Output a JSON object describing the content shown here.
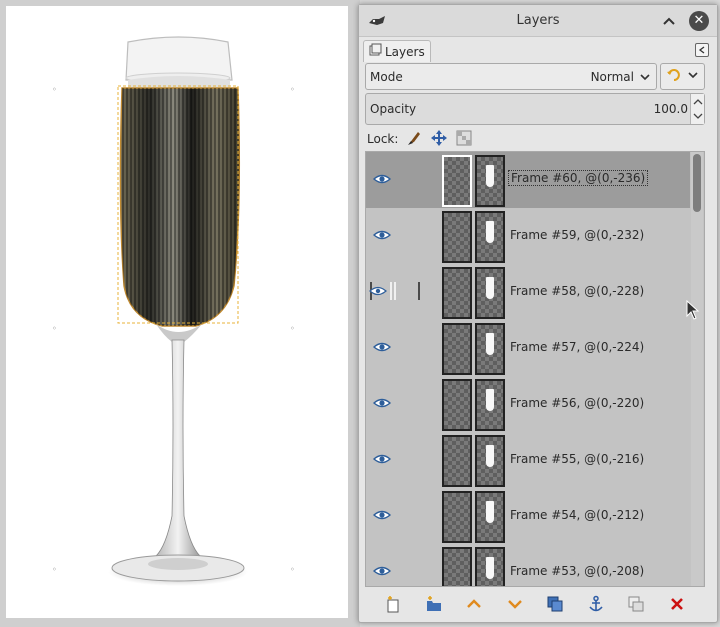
{
  "dialog": {
    "title": "Layers",
    "tab_label": "Layers",
    "mode_label": "Mode",
    "mode_value": "Normal",
    "opacity_label": "Opacity",
    "opacity_value": "100.0",
    "lock_label": "Lock:"
  },
  "layers": [
    {
      "name": "Frame #60, @(0,-236)",
      "selected": true
    },
    {
      "name": "Frame #59, @(0,-232)",
      "selected": false
    },
    {
      "name": "Frame #58, @(0,-228)",
      "selected": false
    },
    {
      "name": "Frame #57, @(0,-224)",
      "selected": false
    },
    {
      "name": "Frame #56, @(0,-220)",
      "selected": false
    },
    {
      "name": "Frame #55, @(0,-216)",
      "selected": false
    },
    {
      "name": "Frame #54, @(0,-212)",
      "selected": false
    },
    {
      "name": "Frame #53, @(0,-208)",
      "selected": false
    }
  ],
  "icons": {
    "dialog": [
      "app-icon",
      "collapse-up-icon",
      "close-icon",
      "tab-layers-icon",
      "tab-menu-icon",
      "chevron-down-icon",
      "mode-switch-icon"
    ],
    "lock": [
      "lock-pixels-brush-icon",
      "lock-position-move-icon",
      "lock-alpha-icon"
    ],
    "bottom": [
      "new-layer-icon",
      "new-layer-group-icon",
      "raise-layer-icon",
      "lower-layer-icon",
      "duplicate-layer-icon",
      "anchor-layer-icon",
      "merge-down-icon",
      "delete-layer-icon"
    ]
  },
  "colors": {
    "selected_row": "#9c9c9c",
    "row": "#c3c3c3",
    "delete": "#cc1111",
    "arrows": "#e08a1e",
    "selection_border": "#e8b33a"
  }
}
